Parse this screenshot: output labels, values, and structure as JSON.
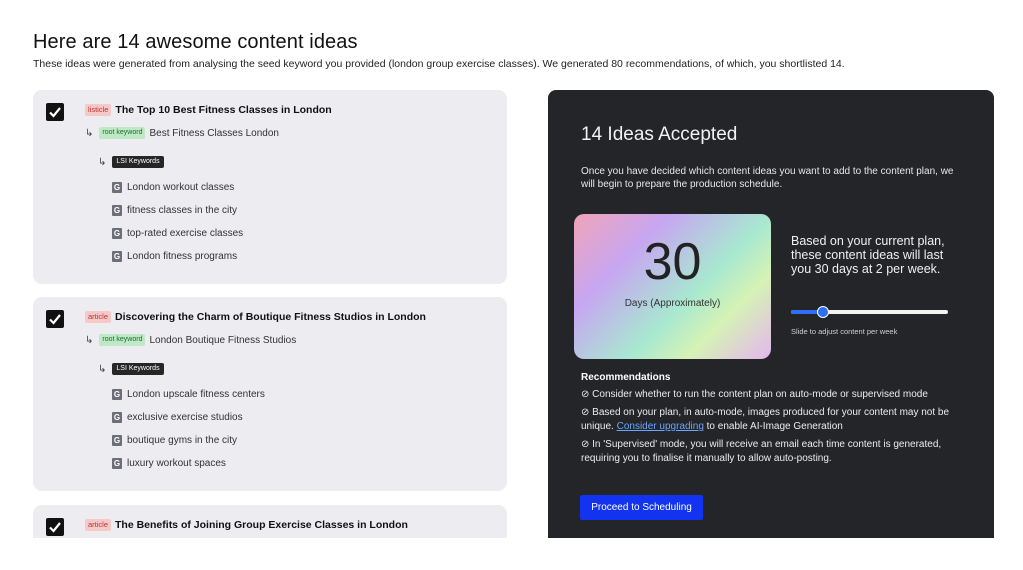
{
  "header": {
    "title": "Here are 14 awesome content ideas",
    "subtitle": "These ideas were generated from analysing the seed keyword you provided (london group exercise classes). We generated 80 recommendations, of which, you shortlisted 14."
  },
  "ideas": [
    {
      "checked": true,
      "type": "listicle",
      "title": "The Top 10 Best Fitness Classes in London",
      "root_badge": "root keyword",
      "root_keyword": "Best Fitness Classes London",
      "lsi_badge": "LSI Keywords",
      "lsi_keywords": [
        "London workout classes",
        "fitness classes in the city",
        "top-rated exercise classes",
        "London fitness programs"
      ]
    },
    {
      "checked": true,
      "type": "article",
      "title": "Discovering the Charm of Boutique Fitness Studios in London",
      "root_badge": "root keyword",
      "root_keyword": "London Boutique Fitness Studios",
      "lsi_badge": "LSI Keywords",
      "lsi_keywords": [
        "London upscale fitness centers",
        "exclusive exercise studios",
        "boutique gyms in the city",
        "luxury workout spaces"
      ]
    },
    {
      "checked": true,
      "type": "article",
      "title": "The Benefits of Joining Group Exercise Classes in London"
    }
  ],
  "icons": {
    "checkbox": "checkmark-icon",
    "arrow": "return-arrow-icon",
    "google": "google-g-icon",
    "rec_bullet": "check-circle-icon"
  },
  "panel": {
    "title": "14 Ideas Accepted",
    "intro": "Once you have decided which content ideas you want to add to the content plan, we will begin to prepare the production schedule.",
    "days_value": "30",
    "days_label": "Days (Approximately)",
    "lasting_text": "Based on your current plan, these content ideas will last you 30 days at 2 per week.",
    "slider_value_fraction": 0.18,
    "slider_caption": "Slide to adjust content per week",
    "recommendations_heading": "Recommendations",
    "recommendations": {
      "r1": "⊘ Consider whether to run the content plan on auto-mode or supervised mode",
      "r2_before": "⊘ Based on your plan, in auto-mode, images produced for your content may not be unique. ",
      "r2_link": "Consider upgrading",
      "r2_after": " to enable AI-Image Generation",
      "r3": "⊘ In 'Supervised' mode, you will receive an email each time content is generated, requiring you to finalise it manually to allow auto-posting."
    },
    "proceed_button": "Proceed to Scheduling"
  },
  "colors": {
    "panel_bg": "#232528",
    "card_bg": "#ececf1",
    "accent_blue": "#1233f0",
    "link_blue": "#6aa5ff",
    "listicle_badge": "#f6c9c9",
    "root_badge": "#bfe8c5"
  }
}
